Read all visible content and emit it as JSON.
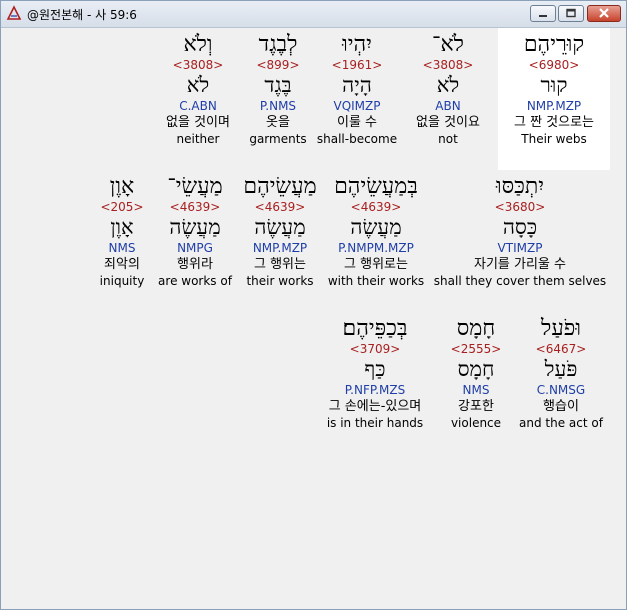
{
  "window": {
    "title": "@원전본해 - 사 59:6"
  },
  "rows": [
    [
      {
        "heb": "קוּרֵיהֶם",
        "strong": "<6980>",
        "lemma": "קוּר",
        "morph": "NMP.MZP",
        "kor": "그 짠 것으로는",
        "eng": "Their webs",
        "highlight": true
      },
      {
        "heb": "לֹא־",
        "strong": "<3808>",
        "lemma": "לֹא",
        "morph": "ABN",
        "kor": "없을 것이요",
        "eng": "not",
        "highlight": false
      },
      {
        "heb": "יִהְיוּ",
        "strong": "<1961>",
        "lemma": "הָיָה",
        "morph": "VQIMZP",
        "kor": "이룰 수",
        "eng": "shall-become",
        "highlight": false
      },
      {
        "heb": "לְבֶגֶד",
        "strong": "<899>",
        "lemma": "בֶּגֶד",
        "morph": "P.NMS",
        "kor": "옷을",
        "eng": "garments",
        "highlight": false
      },
      {
        "heb": "וְלֹא",
        "strong": "<3808>",
        "lemma": "לֹא",
        "morph": "C.ABN",
        "kor": "없을 것이며",
        "eng": "neither",
        "highlight": false
      }
    ],
    [
      {
        "heb": "יִתְכַּסּוּ",
        "strong": "<3680>",
        "lemma": "כָּסָה",
        "morph": "VTIMZP",
        "kor": "자기를 가리울 수",
        "eng": "shall they cover them selves",
        "highlight": false
      },
      {
        "heb": "בְּמַעֲשֵׂיהֶם",
        "strong": "<4639>",
        "lemma": "מַעֲשֶׂה",
        "morph": "P.NMPM.MZP",
        "kor": "그 행위로는",
        "eng": "with their works",
        "highlight": false
      },
      {
        "heb": "מַעֲשֵׂיהֶם",
        "strong": "<4639>",
        "lemma": "מַעֲשֶׂה",
        "morph": "NMP.MZP",
        "kor": "그 행위는",
        "eng": "their works",
        "highlight": false
      },
      {
        "heb": "מַעֲשֵׂי־",
        "strong": "<4639>",
        "lemma": "מַעֲשֶׂה",
        "morph": "NMPG",
        "kor": "행위라",
        "eng": "are works of",
        "highlight": false
      },
      {
        "heb": "אָוֶן",
        "strong": "<205>",
        "lemma": "אָוֶן",
        "morph": "NMS",
        "kor": "죄악의",
        "eng": "iniquity",
        "highlight": false
      }
    ],
    [
      {
        "heb": "וּפֹעַל",
        "strong": "<6467>",
        "lemma": "פֹּעַל",
        "morph": "C.NMSG",
        "kor": "행습이",
        "eng": "and the act of",
        "highlight": false
      },
      {
        "heb": "חָמָס",
        "strong": "<2555>",
        "lemma": "חָמָס",
        "morph": "NMS",
        "kor": "강포한",
        "eng": "violence",
        "highlight": false
      },
      {
        "heb": "בְּכַפֵּיהֶם׃",
        "strong": "<3709>",
        "lemma": "כַּף",
        "morph": "P.NFP.MZS",
        "kor": "그 손에는-있으며",
        "eng": "is in their hands",
        "highlight": false
      }
    ]
  ]
}
